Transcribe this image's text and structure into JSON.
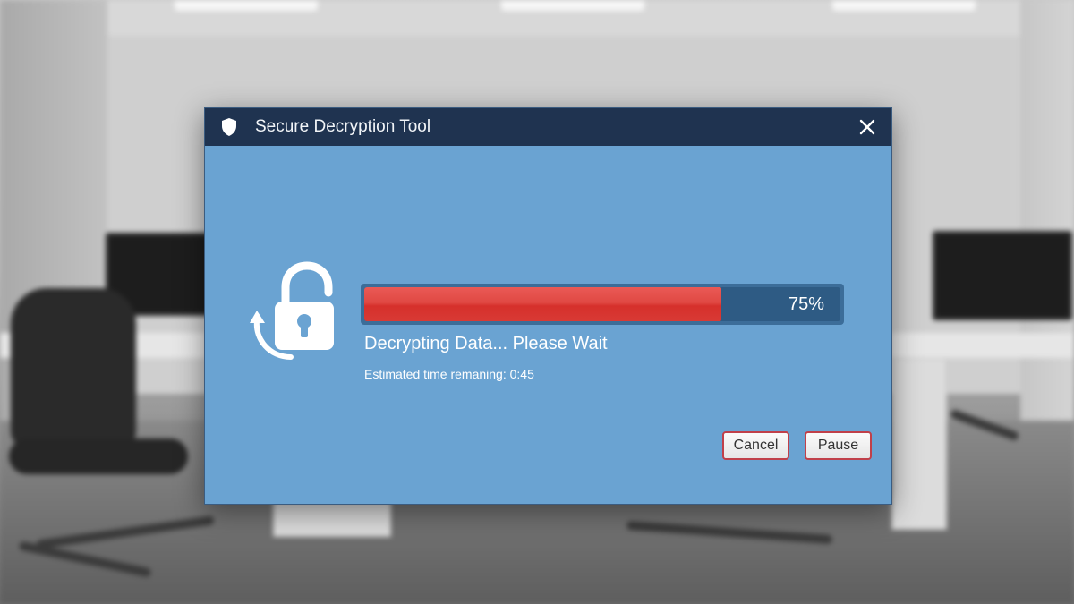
{
  "window": {
    "title": "Secure Decryption Tool",
    "close_icon": "close-icon",
    "title_icon": "shield-icon"
  },
  "progress": {
    "value": 0.75,
    "label": "75%",
    "color": "#d8342f"
  },
  "status": {
    "message": "Decrypting Data... Please Wait",
    "eta": "Estimated time remaning: 0:45"
  },
  "buttons": {
    "cancel": "Cancel",
    "pause": "Pause"
  },
  "icons": {
    "main": "unlock-refresh-icon"
  },
  "colors": {
    "dialog_bg": "#6aa3d2",
    "titlebar_bg": "#1f3350",
    "button_border": "#c0404a"
  }
}
